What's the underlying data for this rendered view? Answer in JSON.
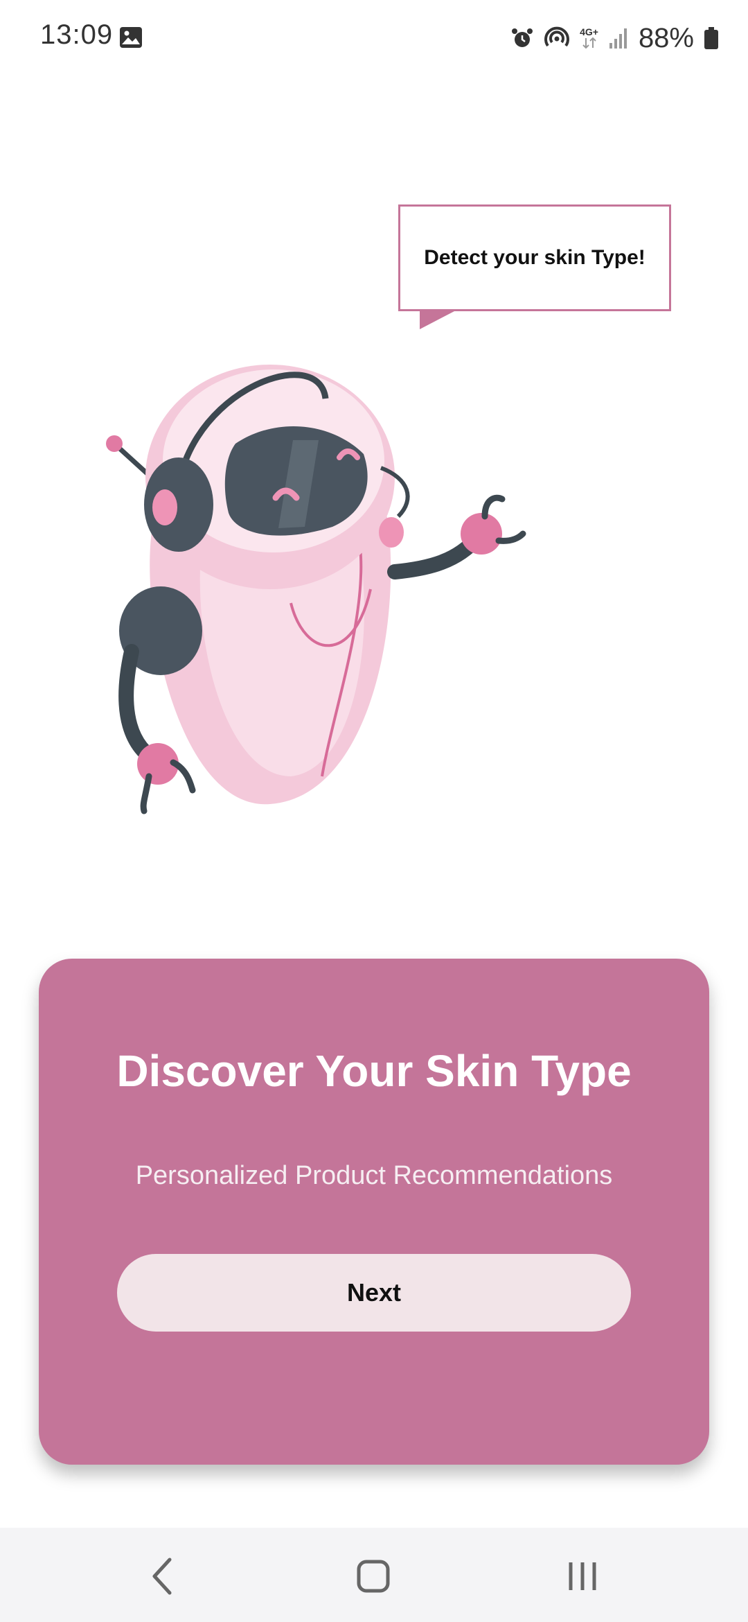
{
  "status_bar": {
    "time": "13:09",
    "battery": "88%",
    "network_label": "4G+",
    "icons": [
      "gallery-icon",
      "alarm-icon",
      "hotspot-icon",
      "signal-icon",
      "battery-icon"
    ]
  },
  "illustration": {
    "bubble_text": "Detect your skin Type!"
  },
  "card": {
    "title": "Discover Your Skin Type",
    "subtitle": "Personalized Product Recommendations",
    "next_label": "Next"
  },
  "nav_bar": {
    "icons": [
      "back-icon",
      "home-icon",
      "recents-icon"
    ]
  },
  "colors": {
    "accent": "#c47599",
    "button_bg": "#f2e4e8",
    "robot_dark": "#4a5560",
    "robot_pink": "#f2c6d8"
  }
}
